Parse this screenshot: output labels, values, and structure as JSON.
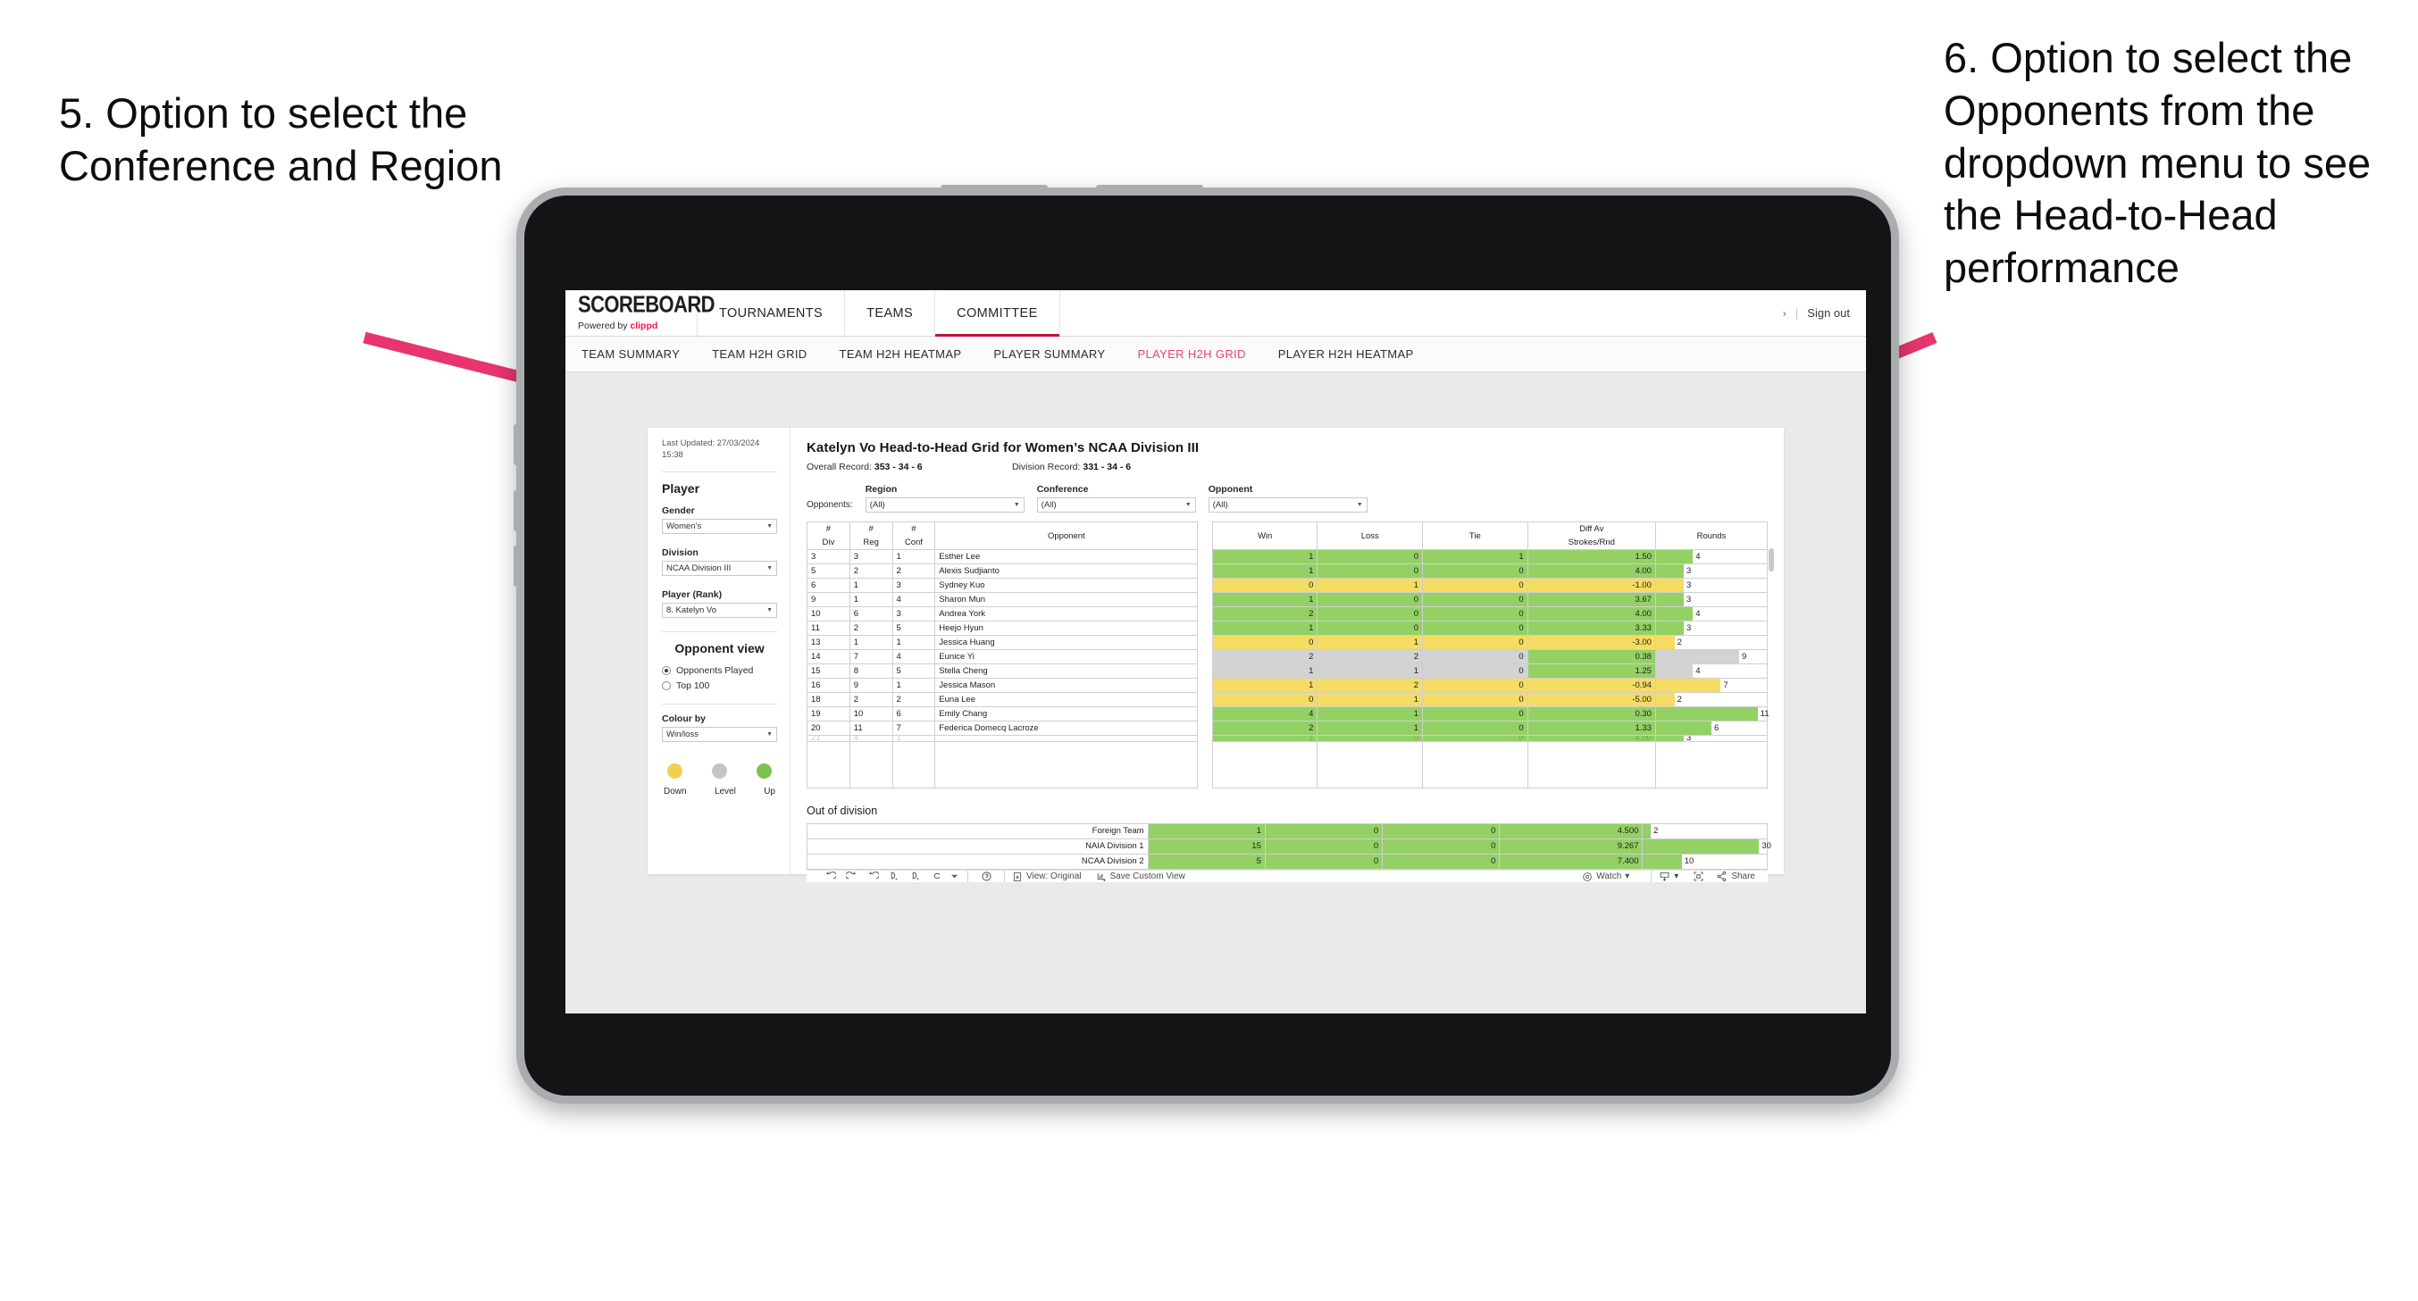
{
  "annotations": {
    "left": "5. Option to select the Conference and Region",
    "right": "6. Option to select the Opponents from the dropdown menu to see the Head-to-Head performance"
  },
  "colors": {
    "accent_pink": "#e8194b",
    "tab_active": "#e8456e",
    "arrow": "#e8356d",
    "up_green": "#94d164",
    "level_grey": "#c9cacb",
    "down_yellow": "#f5dc62"
  },
  "app": {
    "logo": {
      "word": "SCOREBOARD",
      "powered_prefix": "Powered by ",
      "brand": "clippd"
    },
    "top_nav": [
      {
        "label": "TOURNAMENTS",
        "active": false
      },
      {
        "label": "TEAMS",
        "active": false
      },
      {
        "label": "COMMITTEE",
        "active": true
      }
    ],
    "header_right": {
      "chevron": "›",
      "separator": "|",
      "sign_out": "Sign out"
    },
    "sub_nav": [
      {
        "label": "TEAM SUMMARY",
        "active": false
      },
      {
        "label": "TEAM H2H GRID",
        "active": false
      },
      {
        "label": "TEAM H2H HEATMAP",
        "active": false
      },
      {
        "label": "PLAYER SUMMARY",
        "active": false
      },
      {
        "label": "PLAYER H2H GRID",
        "active": true
      },
      {
        "label": "PLAYER H2H HEATMAP",
        "active": false
      }
    ]
  },
  "sidebar": {
    "last_updated": "Last Updated: 27/03/2024 15:38",
    "player_heading": "Player",
    "gender": {
      "label": "Gender",
      "value": "Women’s"
    },
    "division": {
      "label": "Division",
      "value": "NCAA Division III"
    },
    "player_rank": {
      "label": "Player (Rank)",
      "value": "8. Katelyn Vo"
    },
    "opponent_view": {
      "heading": "Opponent view",
      "options": [
        {
          "label": "Opponents Played",
          "selected": true
        },
        {
          "label": "Top 100",
          "selected": false
        }
      ]
    },
    "colour_by": {
      "label": "Colour by",
      "value": "Win/loss"
    },
    "legend": [
      {
        "label": "Down",
        "color": "#f0d04e"
      },
      {
        "label": "Level",
        "color": "#c3c4c6"
      },
      {
        "label": "Up",
        "color": "#7cc24f"
      }
    ]
  },
  "main": {
    "title": "Katelyn Vo Head-to-Head Grid for Women’s NCAA Division III",
    "overall_record": {
      "label": "Overall Record:",
      "value": "353 - 34 - 6"
    },
    "division_record": {
      "label": "Division Record:",
      "value": "331 - 34 - 6"
    },
    "opponents_label": "Opponents:",
    "filters": [
      {
        "label": "Region",
        "value": "(All)"
      },
      {
        "label": "Conference",
        "value": "(All)"
      },
      {
        "label": "Opponent",
        "value": "(All)"
      }
    ],
    "out_of_division_title": "Out of division"
  },
  "chart_data": {
    "type": "table",
    "title": "Katelyn Vo Head-to-Head Grid for Women’s NCAA Division III",
    "columns": [
      "# Div",
      "# Reg",
      "# Conf",
      "Opponent",
      "Win",
      "Loss",
      "Tie",
      "Diff Av Strokes/Rnd",
      "Rounds"
    ],
    "rounds_axis_max": 12,
    "rows": [
      {
        "div": "3",
        "reg": "3",
        "conf": "1",
        "opponent": "Esther Lee",
        "win": "1",
        "loss": "0",
        "tie": "1",
        "diff": "1.50",
        "rounds": "4",
        "color": "#94d164"
      },
      {
        "div": "5",
        "reg": "2",
        "conf": "2",
        "opponent": "Alexis Sudjianto",
        "win": "1",
        "loss": "0",
        "tie": "0",
        "diff": "4.00",
        "rounds": "3",
        "color": "#94d164"
      },
      {
        "div": "6",
        "reg": "1",
        "conf": "3",
        "opponent": "Sydney Kuo",
        "win": "0",
        "loss": "1",
        "tie": "0",
        "diff": "-1.00",
        "rounds": "3",
        "color": "#f5dc62"
      },
      {
        "div": "9",
        "reg": "1",
        "conf": "4",
        "opponent": "Sharon Mun",
        "win": "1",
        "loss": "0",
        "tie": "0",
        "diff": "3.67",
        "rounds": "3",
        "color": "#94d164"
      },
      {
        "div": "10",
        "reg": "6",
        "conf": "3",
        "opponent": "Andrea York",
        "win": "2",
        "loss": "0",
        "tie": "0",
        "diff": "4.00",
        "rounds": "4",
        "color": "#94d164"
      },
      {
        "div": "11",
        "reg": "2",
        "conf": "5",
        "opponent": "Heejo Hyun",
        "win": "1",
        "loss": "0",
        "tie": "0",
        "diff": "3.33",
        "rounds": "3",
        "color": "#94d164"
      },
      {
        "div": "13",
        "reg": "1",
        "conf": "1",
        "opponent": "Jessica Huang",
        "win": "0",
        "loss": "1",
        "tie": "0",
        "diff": "-3.00",
        "rounds": "2",
        "color": "#f5dc62"
      },
      {
        "div": "14",
        "reg": "7",
        "conf": "4",
        "opponent": "Eunice Yi",
        "win": "2",
        "loss": "2",
        "tie": "0",
        "diff": "0.38",
        "rounds": "9",
        "color": "#d2d3d3",
        "diff_color": "#94d164"
      },
      {
        "div": "15",
        "reg": "8",
        "conf": "5",
        "opponent": "Stella Cheng",
        "win": "1",
        "loss": "1",
        "tie": "0",
        "diff": "1.25",
        "rounds": "4",
        "color": "#d2d3d3",
        "diff_color": "#94d164"
      },
      {
        "div": "16",
        "reg": "9",
        "conf": "1",
        "opponent": "Jessica Mason",
        "win": "1",
        "loss": "2",
        "tie": "0",
        "diff": "-0.94",
        "rounds": "7",
        "color": "#f5dc62"
      },
      {
        "div": "18",
        "reg": "2",
        "conf": "2",
        "opponent": "Euna Lee",
        "win": "0",
        "loss": "1",
        "tie": "0",
        "diff": "-5.00",
        "rounds": "2",
        "color": "#f5dc62"
      },
      {
        "div": "19",
        "reg": "10",
        "conf": "6",
        "opponent": "Emily Chang",
        "win": "4",
        "loss": "1",
        "tie": "0",
        "diff": "0.30",
        "rounds": "11",
        "color": "#94d164"
      },
      {
        "div": "20",
        "reg": "11",
        "conf": "7",
        "opponent": "Federica Domecq Lacroze",
        "win": "2",
        "loss": "1",
        "tie": "0",
        "diff": "1.33",
        "rounds": "6",
        "color": "#94d164"
      }
    ],
    "out_of_division": {
      "rounds_axis_max": 32,
      "rows": [
        {
          "name": "Foreign Team",
          "win": "1",
          "loss": "0",
          "tie": "0",
          "diff": "4.500",
          "rounds": "2",
          "color": "#94d164"
        },
        {
          "name": "NAIA Division 1",
          "win": "15",
          "loss": "0",
          "tie": "0",
          "diff": "9.267",
          "rounds": "30",
          "color": "#94d164"
        },
        {
          "name": "NCAA Division 2",
          "win": "5",
          "loss": "0",
          "tie": "0",
          "diff": "7.400",
          "rounds": "10",
          "color": "#94d164"
        }
      ]
    }
  },
  "toolbar": {
    "view_original": "View: Original",
    "save_custom_view": "Save Custom View",
    "watch": "Watch",
    "share": "Share",
    "caret": "▾"
  }
}
